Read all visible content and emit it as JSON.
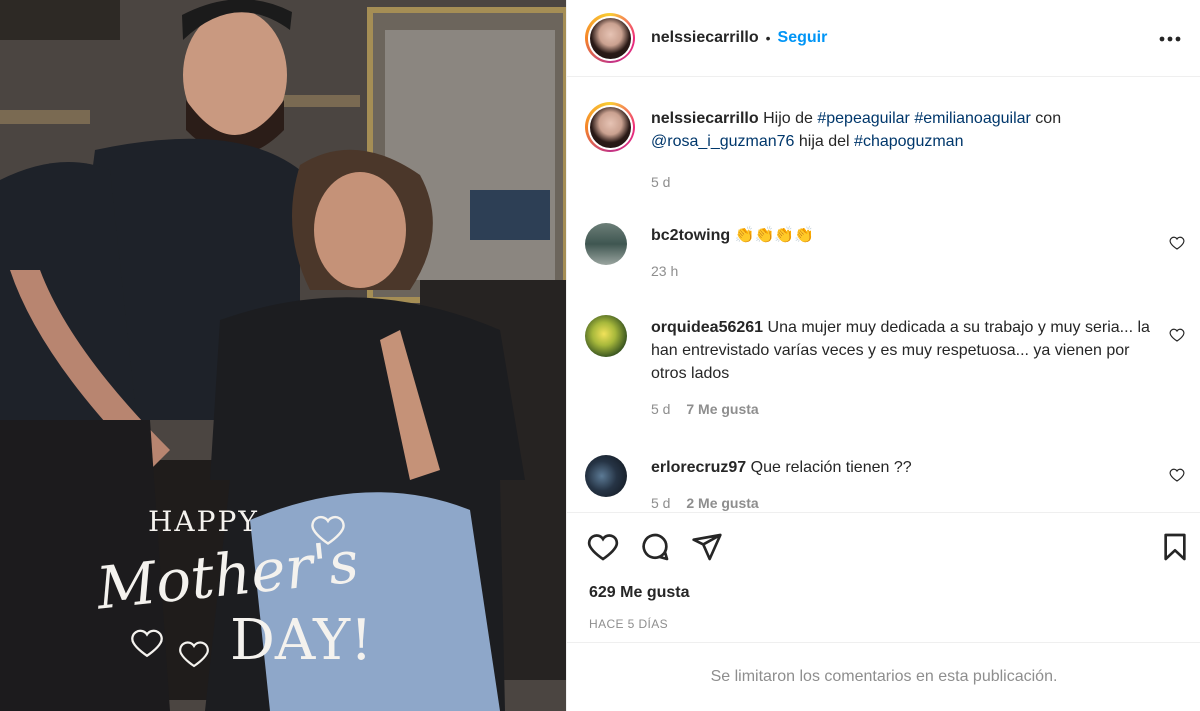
{
  "post": {
    "username": "nelssiecarrillo",
    "separator": "•",
    "follow_label": "Seguir",
    "caption": {
      "username": "nelssiecarrillo",
      "text_1": "Hijo de",
      "tag_1": "#pepeaguilar",
      "tag_2": "#emilianoaguilar",
      "text_2": "con",
      "tag_3": "@rosa_i_guzman76",
      "text_3": "hija del",
      "tag_4": "#chapoguzman",
      "time": "5 d"
    },
    "comments": [
      {
        "username": "bc2towing",
        "text": "👏👏👏👏",
        "time": "23 h",
        "likes": ""
      },
      {
        "username": "orquidea56261",
        "text": "Una mujer muy dedicada a su trabajo y muy seria... la han entrevistado varías veces y es muy respetuosa... ya vienen por otros lados",
        "time": "5 d",
        "likes": "7 Me gusta"
      },
      {
        "username": "erlorecruz97",
        "text": "Que relación tienen ??",
        "time": "5 d",
        "likes": "2 Me gusta"
      }
    ],
    "likes_count": "629 Me gusta",
    "posted_ago": "HACE 5 DÍAS",
    "comments_limited": "Se limitaron los comentarios en esta publicación."
  },
  "photo": {
    "overlay_happy": "HAPPY",
    "overlay_mothers": "Mother's",
    "overlay_day": "DAY!"
  },
  "icons": {
    "more": "more-horizontal-icon",
    "like": "heart-icon",
    "comment": "comment-icon",
    "share": "send-icon",
    "save": "bookmark-icon"
  },
  "colors": {
    "follow": "#0095f6",
    "text": "#262626",
    "secondary": "#8e8e8e",
    "tag": "#00376b"
  }
}
